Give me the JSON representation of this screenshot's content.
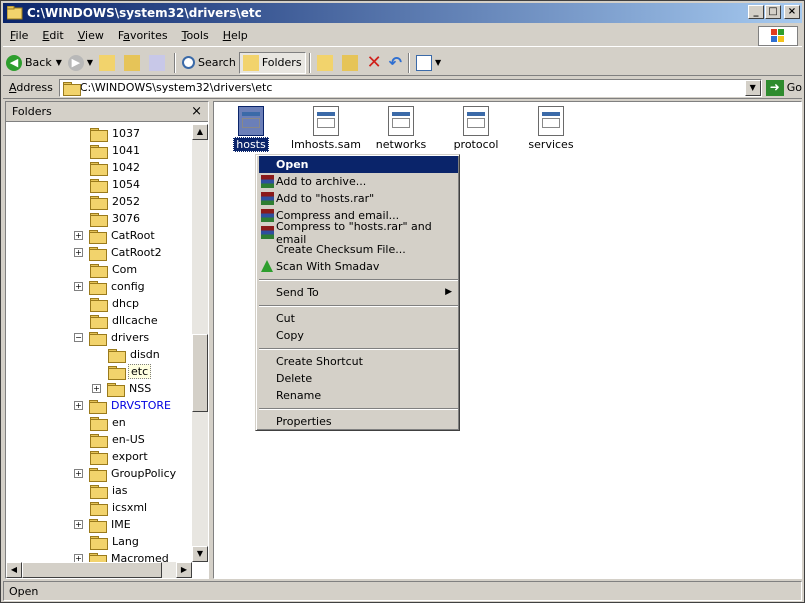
{
  "window": {
    "title": "C:\\WINDOWS\\system32\\drivers\\etc"
  },
  "menu": [
    "File",
    "Edit",
    "View",
    "Favorites",
    "Tools",
    "Help"
  ],
  "toolbar": {
    "back": "Back",
    "search": "Search",
    "folders": "Folders"
  },
  "address": {
    "label": "Address",
    "value": "C:\\WINDOWS\\system32\\drivers\\etc",
    "go": "Go"
  },
  "folders_pane": {
    "title": "Folders",
    "items": [
      {
        "label": "1037",
        "plus": false,
        "indent": 0
      },
      {
        "label": "1041",
        "plus": false,
        "indent": 0
      },
      {
        "label": "1042",
        "plus": false,
        "indent": 0
      },
      {
        "label": "1054",
        "plus": false,
        "indent": 0
      },
      {
        "label": "2052",
        "plus": false,
        "indent": 0
      },
      {
        "label": "3076",
        "plus": false,
        "indent": 0
      },
      {
        "label": "CatRoot",
        "plus": true,
        "indent": 0
      },
      {
        "label": "CatRoot2",
        "plus": true,
        "indent": 0
      },
      {
        "label": "Com",
        "plus": false,
        "indent": 0
      },
      {
        "label": "config",
        "plus": true,
        "indent": 0
      },
      {
        "label": "dhcp",
        "plus": false,
        "indent": 0
      },
      {
        "label": "dllcache",
        "plus": false,
        "indent": 0
      },
      {
        "label": "drivers",
        "plus": "minus",
        "indent": 0
      },
      {
        "label": "disdn",
        "plus": false,
        "indent": 1
      },
      {
        "label": "etc",
        "plus": false,
        "indent": 1,
        "selected": true
      },
      {
        "label": "NSS",
        "plus": true,
        "indent": 1
      },
      {
        "label": "DRVSTORE",
        "plus": true,
        "indent": 0,
        "blue": true
      },
      {
        "label": "en",
        "plus": false,
        "indent": 0
      },
      {
        "label": "en-US",
        "plus": false,
        "indent": 0
      },
      {
        "label": "export",
        "plus": false,
        "indent": 0
      },
      {
        "label": "GroupPolicy",
        "plus": true,
        "indent": 0
      },
      {
        "label": "ias",
        "plus": false,
        "indent": 0
      },
      {
        "label": "icsxml",
        "plus": false,
        "indent": 0
      },
      {
        "label": "IME",
        "plus": true,
        "indent": 0
      },
      {
        "label": "Lang",
        "plus": false,
        "indent": 0
      },
      {
        "label": "Macromed",
        "plus": true,
        "indent": 0
      }
    ]
  },
  "files": [
    {
      "name": "hosts",
      "selected": true
    },
    {
      "name": "lmhosts.sam",
      "selected": false
    },
    {
      "name": "networks",
      "selected": false
    },
    {
      "name": "protocol",
      "selected": false
    },
    {
      "name": "services",
      "selected": false
    }
  ],
  "context_menu": {
    "items": [
      {
        "label": "Open",
        "highlight": true
      },
      {
        "label": "Add to archive...",
        "icon": "winrar-icon"
      },
      {
        "label": "Add to \"hosts.rar\"",
        "icon": "winrar-icon"
      },
      {
        "label": "Compress and email...",
        "icon": "winrar-icon"
      },
      {
        "label": "Compress to \"hosts.rar\" and email",
        "icon": "winrar-icon"
      },
      {
        "label": "Create Checksum File..."
      },
      {
        "label": "Scan With Smadav",
        "icon": "smadav-icon"
      },
      {
        "sep": true
      },
      {
        "label": "Send To",
        "submenu": true
      },
      {
        "sep": true
      },
      {
        "label": "Cut"
      },
      {
        "label": "Copy"
      },
      {
        "sep": true
      },
      {
        "label": "Create Shortcut"
      },
      {
        "label": "Delete"
      },
      {
        "label": "Rename"
      },
      {
        "sep": true
      },
      {
        "label": "Properties"
      }
    ]
  },
  "status": {
    "text": "Open"
  }
}
